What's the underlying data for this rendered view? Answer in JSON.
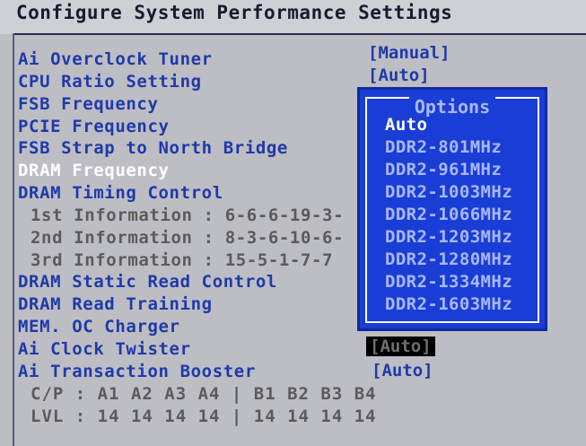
{
  "title": "Configure System Performance Settings",
  "items": [
    {
      "label": "Ai Overclock Tuner",
      "value": "[Manual]"
    },
    {
      "label": "CPU Ratio Setting",
      "value": "[Auto]"
    },
    {
      "label": "FSB Frequency",
      "value": ""
    },
    {
      "label": "PCIE Frequency",
      "value": ""
    },
    {
      "label": "FSB Strap to North Bridge",
      "value": ""
    },
    {
      "label": "DRAM Frequency",
      "value": ""
    },
    {
      "label": "DRAM Timing Control",
      "value": ""
    },
    {
      "label": "1st Information : 6-6-6-19-3-",
      "value": ""
    },
    {
      "label": "2nd Information : 8-3-6-10-6-",
      "value": ""
    },
    {
      "label": "3rd Information : 15-5-1-7-7",
      "value": ""
    },
    {
      "label": "DRAM Static Read Control",
      "value": ""
    },
    {
      "label": "DRAM Read Training",
      "value": ""
    },
    {
      "label": "MEM. OC Charger",
      "value": ""
    },
    {
      "label": "Ai Clock Twister",
      "value": "[Auto]"
    },
    {
      "label": "Ai Transaction Booster",
      "value": "[Auto]"
    }
  ],
  "footer": {
    "cp": "C/P : A1 A2 A3 A4 | B1 B2 B3 B4",
    "lvl": "LVL : 14 14 14 14 | 14 14 14 14"
  },
  "popup": {
    "title": "Options",
    "options": [
      "Auto",
      "DDR2-801MHz",
      "DDR2-961MHz",
      "DDR2-1003MHz",
      "DDR2-1066MHz",
      "DDR2-1203MHz",
      "DDR2-1280MHz",
      "DDR2-1334MHz",
      "DDR2-1603MHz"
    ]
  },
  "colors": {
    "background": "#bdbdc4",
    "item_text": "#1f3aa8",
    "selected_text": "#ffffff",
    "popup_bg": "#1a3dd6"
  }
}
